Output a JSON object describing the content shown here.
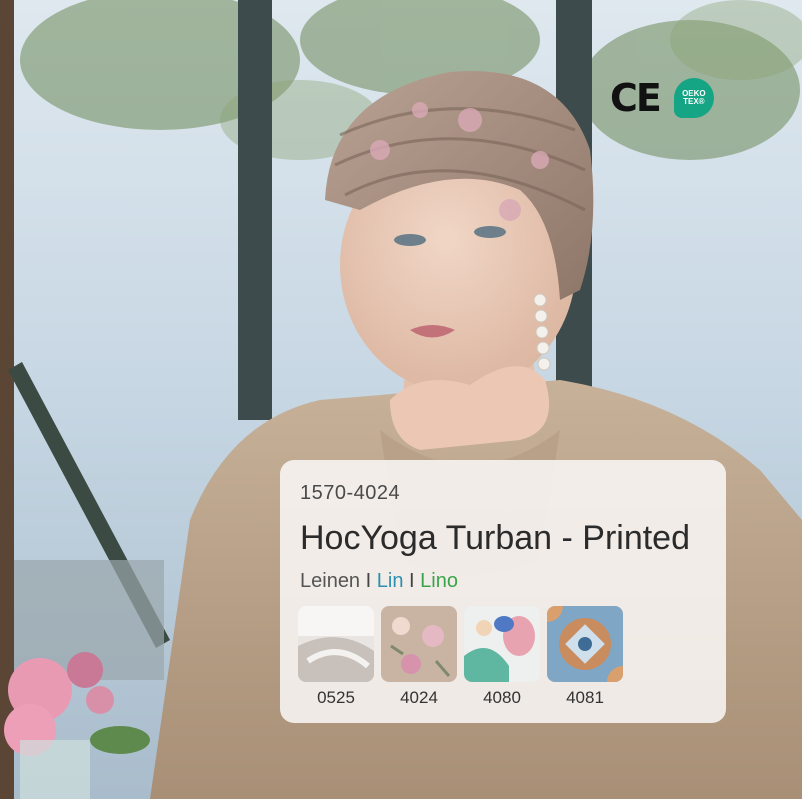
{
  "product": {
    "code": "1570-4024",
    "name": "HocYoga Turban - Printed",
    "materials": [
      {
        "label": "Leinen",
        "color": "#555555"
      },
      {
        "label": "Lin",
        "color": "#2e8fb0"
      },
      {
        "label": "Lino",
        "color": "#3aa54a"
      }
    ],
    "separator": "I",
    "swatches": [
      {
        "code": "0525",
        "icon": "white-fabric-swatch"
      },
      {
        "code": "4024",
        "icon": "beige-floral-swatch"
      },
      {
        "code": "4080",
        "icon": "watercolor-floral-swatch"
      },
      {
        "code": "4081",
        "icon": "tile-pattern-swatch"
      }
    ]
  },
  "certifications": {
    "ce": "CE",
    "oeko_line1": "OEKO",
    "oeko_line2": "TEX®",
    "oeko_color": "#15a585"
  }
}
